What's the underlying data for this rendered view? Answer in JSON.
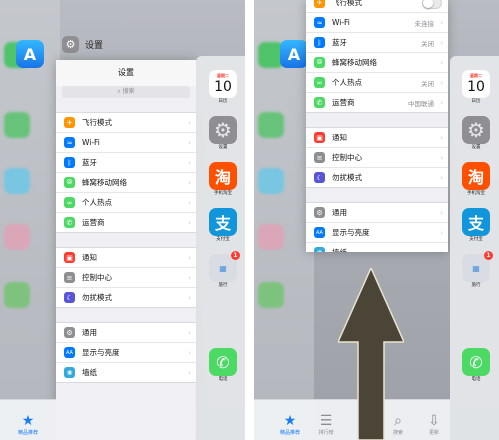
{
  "left": {
    "app_header": {
      "title": "设置"
    },
    "nav_title": "设置",
    "search_placeholder": "搜索",
    "groups": [
      {
        "items": [
          {
            "label": "飞行模式",
            "icon": "airplane-icon",
            "color": "#ff9500",
            "glyph": "✈"
          },
          {
            "label": "Wi-Fi",
            "icon": "wifi-icon",
            "color": "#007aff",
            "glyph": "≈"
          },
          {
            "label": "蓝牙",
            "icon": "bluetooth-icon",
            "color": "#007aff",
            "glyph": "ᛒ"
          },
          {
            "label": "蜂窝移动网络",
            "icon": "cellular-icon",
            "color": "#4cd964",
            "glyph": "⦾"
          },
          {
            "label": "个人热点",
            "icon": "hotspot-icon",
            "color": "#4cd964",
            "glyph": "∞"
          },
          {
            "label": "运营商",
            "icon": "carrier-icon",
            "color": "#4cd964",
            "glyph": "✆"
          }
        ]
      },
      {
        "items": [
          {
            "label": "通知",
            "icon": "notifications-icon",
            "color": "#ff3b30",
            "glyph": "▣"
          },
          {
            "label": "控制中心",
            "icon": "control-center-icon",
            "color": "#8e8e93",
            "glyph": "≡"
          },
          {
            "label": "勿扰模式",
            "icon": "do-not-disturb-icon",
            "color": "#5856d6",
            "glyph": "☾"
          }
        ]
      },
      {
        "items": [
          {
            "label": "通用",
            "icon": "general-icon",
            "color": "#8e8e93",
            "glyph": "⚙"
          },
          {
            "label": "显示与亮度",
            "icon": "display-icon",
            "color": "#007aff",
            "glyph": "AA"
          },
          {
            "label": "墙纸",
            "icon": "wallpaper-icon",
            "color": "#34aadc",
            "glyph": "❀"
          }
        ]
      }
    ],
    "dock": {
      "featured_label": "精品推荐"
    }
  },
  "right": {
    "groups": [
      {
        "items": [
          {
            "label": "飞行模式",
            "icon": "airplane-icon",
            "color": "#ff9500",
            "glyph": "✈",
            "toggle": true
          },
          {
            "label": "Wi-Fi",
            "icon": "wifi-icon",
            "color": "#007aff",
            "glyph": "≈",
            "value": "未连接"
          },
          {
            "label": "蓝牙",
            "icon": "bluetooth-icon",
            "color": "#007aff",
            "glyph": "ᛒ",
            "value": "关闭"
          },
          {
            "label": "蜂窝移动网络",
            "icon": "cellular-icon",
            "color": "#4cd964",
            "glyph": "⦾"
          },
          {
            "label": "个人热点",
            "icon": "hotspot-icon",
            "color": "#4cd964",
            "glyph": "∞",
            "value": "关闭"
          },
          {
            "label": "运营商",
            "icon": "carrier-icon",
            "color": "#4cd964",
            "glyph": "✆",
            "value": "中国联通"
          }
        ]
      },
      {
        "items": [
          {
            "label": "通知",
            "icon": "notifications-icon",
            "color": "#ff3b30",
            "glyph": "▣"
          },
          {
            "label": "控制中心",
            "icon": "control-center-icon",
            "color": "#8e8e93",
            "glyph": "≡"
          },
          {
            "label": "勿扰模式",
            "icon": "do-not-disturb-icon",
            "color": "#5856d6",
            "glyph": "☾"
          }
        ]
      },
      {
        "items": [
          {
            "label": "通用",
            "icon": "general-icon",
            "color": "#8e8e93",
            "glyph": "⚙"
          },
          {
            "label": "显示与亮度",
            "icon": "display-icon",
            "color": "#007aff",
            "glyph": "AA"
          },
          {
            "label": "墙纸",
            "icon": "wallpaper-icon",
            "color": "#34aadc",
            "glyph": "❀"
          }
        ]
      }
    ],
    "dock": {
      "featured_label": "精品推荐",
      "ranking_label": "排行榜",
      "search_label": "搜索",
      "updates_label": "更新"
    }
  },
  "apps": {
    "calendar": {
      "weekday": "星期二",
      "day": "10",
      "label": "日历"
    },
    "settings": {
      "label": "设置"
    },
    "taobao": {
      "glyph": "淘",
      "label": "手机淘宝"
    },
    "alipay": {
      "glyph": "支",
      "label": "支付宝"
    },
    "folder": {
      "badge": "1",
      "label": "旅行"
    },
    "phone": {
      "label": "电话"
    }
  }
}
